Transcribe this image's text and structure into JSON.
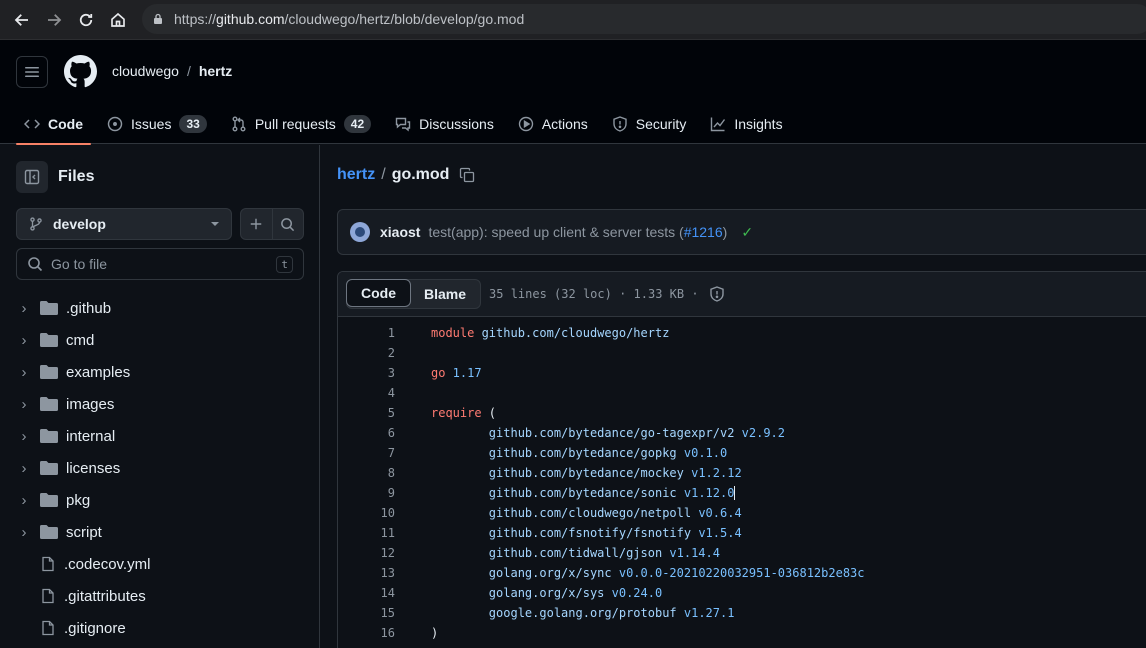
{
  "browser": {
    "url_prefix": "https://",
    "url_host": "github.com",
    "url_path": "/cloudwego/hertz/blob/develop/go.mod"
  },
  "header": {
    "owner": "cloudwego",
    "separator": "/",
    "repo": "hertz",
    "tabs": [
      {
        "label": "Code",
        "icon": "code-icon",
        "active": true
      },
      {
        "label": "Issues",
        "icon": "issue-icon",
        "count": "33"
      },
      {
        "label": "Pull requests",
        "icon": "pull-request-icon",
        "count": "42"
      },
      {
        "label": "Discussions",
        "icon": "discussion-icon"
      },
      {
        "label": "Actions",
        "icon": "play-icon"
      },
      {
        "label": "Security",
        "icon": "shield-icon"
      },
      {
        "label": "Insights",
        "icon": "graph-icon"
      }
    ]
  },
  "sidebar": {
    "title": "Files",
    "branch": "develop",
    "goto_placeholder": "Go to file",
    "goto_shortcut": "t",
    "tree": [
      {
        "name": ".github",
        "type": "folder"
      },
      {
        "name": "cmd",
        "type": "folder"
      },
      {
        "name": "examples",
        "type": "folder"
      },
      {
        "name": "images",
        "type": "folder"
      },
      {
        "name": "internal",
        "type": "folder"
      },
      {
        "name": "licenses",
        "type": "folder"
      },
      {
        "name": "pkg",
        "type": "folder"
      },
      {
        "name": "script",
        "type": "folder"
      },
      {
        "name": ".codecov.yml",
        "type": "file"
      },
      {
        "name": ".gitattributes",
        "type": "file"
      },
      {
        "name": ".gitignore",
        "type": "file"
      }
    ]
  },
  "main": {
    "crumb_repo": "hertz",
    "crumb_sep": "/",
    "file_name": "go.mod",
    "commit": {
      "author": "xiaost",
      "message": "test(app): speed up client & server tests (",
      "pr": "#1216",
      "message_end": ")",
      "status": "✓"
    },
    "toolbar": {
      "code_label": "Code",
      "blame_label": "Blame",
      "meta": "35 lines (32 loc) · 1.33 KB ·"
    },
    "lines": [
      {
        "n": "1",
        "kw": "module",
        "mod": " github.com/cloudwego/hertz",
        "ver": ""
      },
      {
        "n": "2",
        "kw": "",
        "mod": "",
        "ver": ""
      },
      {
        "n": "3",
        "kw": "go",
        "mod": "",
        "ver": " 1.17"
      },
      {
        "n": "4",
        "kw": "",
        "mod": "",
        "ver": ""
      },
      {
        "n": "5",
        "kw": "require",
        "mod": "",
        "ver": "",
        "plain": " ("
      },
      {
        "n": "6",
        "kw": "",
        "mod": "        github.com/bytedance/go-tagexpr/v2",
        "ver": " v2.9.2"
      },
      {
        "n": "7",
        "kw": "",
        "mod": "        github.com/bytedance/gopkg",
        "ver": " v0.1.0"
      },
      {
        "n": "8",
        "kw": "",
        "mod": "        github.com/bytedance/mockey",
        "ver": " v1.2.12"
      },
      {
        "n": "9",
        "kw": "",
        "mod": "        github.com/bytedance/sonic",
        "ver": " v1.12.0",
        "cursor": true
      },
      {
        "n": "10",
        "kw": "",
        "mod": "        github.com/cloudwego/netpoll",
        "ver": " v0.6.4"
      },
      {
        "n": "11",
        "kw": "",
        "mod": "        github.com/fsnotify/fsnotify",
        "ver": " v1.5.4"
      },
      {
        "n": "12",
        "kw": "",
        "mod": "        github.com/tidwall/gjson",
        "ver": " v1.14.4"
      },
      {
        "n": "13",
        "kw": "",
        "mod": "        golang.org/x/sync",
        "ver": " v0.0.0-20210220032951-036812b2e83c"
      },
      {
        "n": "14",
        "kw": "",
        "mod": "        golang.org/x/sys",
        "ver": " v0.24.0"
      },
      {
        "n": "15",
        "kw": "",
        "mod": "        google.golang.org/protobuf",
        "ver": " v1.27.1"
      },
      {
        "n": "16",
        "kw": "",
        "mod": "",
        "ver": "",
        "plain": ")"
      }
    ]
  }
}
